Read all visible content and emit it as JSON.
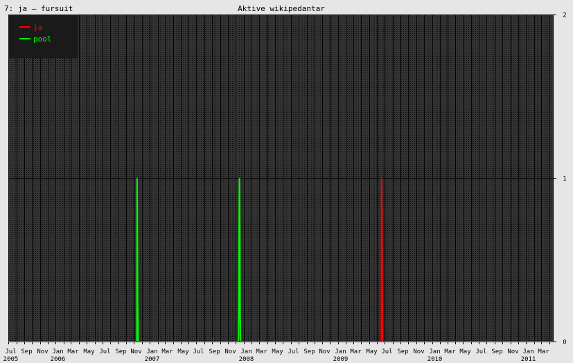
{
  "header": {
    "left_label": "7: ja – fursuit",
    "title": "Aktive wikipedantar"
  },
  "chart_data": {
    "type": "line",
    "title": "Aktive wikipedantar",
    "subtitle": "7: ja – fursuit",
    "xlabel": "",
    "ylabel": "",
    "x_range": [
      "2005-07-01",
      "2011-04-15"
    ],
    "ylim": [
      0,
      2
    ],
    "y_ticks": [
      0,
      1,
      2
    ],
    "x_month_ticks": [
      "Jul",
      "Sep",
      "Nov",
      "Jan",
      "Mar",
      "May",
      "Jul",
      "Sep",
      "Nov",
      "Jan",
      "Mar",
      "May",
      "Jul",
      "Sep",
      "Nov",
      "Jan",
      "Mar",
      "May",
      "Jul",
      "Sep",
      "Nov",
      "Jan",
      "Mar",
      "May",
      "Jul",
      "Sep",
      "Nov",
      "Jan",
      "Mar",
      "May",
      "Jul",
      "Sep",
      "Nov",
      "Jan",
      "Mar"
    ],
    "x_year_ticks": [
      "2005",
      "2006",
      "2007",
      "2008",
      "2009",
      "2010",
      "2011"
    ],
    "grid": true,
    "legend_position": "top-left",
    "colors": {
      "background": "#e6e6e6",
      "plot_background": "#333333",
      "legend_background": "#1a1a1a",
      "grid": "#000000",
      "ja": "#ff0000",
      "pool": "#00ff00"
    },
    "series": [
      {
        "name": "ja",
        "color": "#ff0000",
        "points": [
          [
            "2005-07-01",
            0
          ],
          [
            "2009-06-18",
            0
          ],
          [
            "2009-06-19",
            1
          ],
          [
            "2009-06-20",
            0.8
          ],
          [
            "2009-06-21",
            0.5
          ],
          [
            "2009-06-22",
            0.2
          ],
          [
            "2009-06-23",
            0
          ],
          [
            "2011-04-15",
            0
          ]
        ]
      },
      {
        "name": "pool",
        "color": "#00ff00",
        "points": [
          [
            "2005-07-01",
            0
          ],
          [
            "2006-11-12",
            0
          ],
          [
            "2006-11-13",
            1
          ],
          [
            "2006-11-14",
            0.75
          ],
          [
            "2006-11-15",
            0.25
          ],
          [
            "2006-11-17",
            0
          ],
          [
            "2007-12-12",
            0
          ],
          [
            "2007-12-13",
            0.25
          ],
          [
            "2007-12-14",
            0.75
          ],
          [
            "2007-12-15",
            1
          ],
          [
            "2007-12-16",
            0.85
          ],
          [
            "2007-12-17",
            0.6
          ],
          [
            "2007-12-18",
            0.15
          ],
          [
            "2007-12-20",
            0
          ],
          [
            "2011-04-15",
            0
          ]
        ]
      }
    ]
  }
}
